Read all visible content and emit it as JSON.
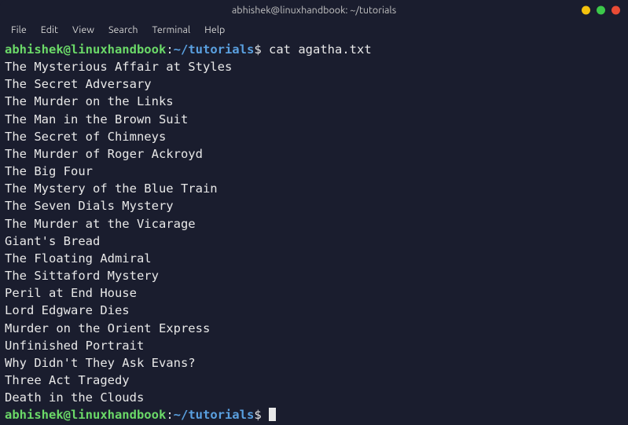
{
  "titlebar": {
    "title": "abhishek@linuxhandbook: ~/tutorials"
  },
  "menubar": {
    "items": [
      "File",
      "Edit",
      "View",
      "Search",
      "Terminal",
      "Help"
    ]
  },
  "prompt": {
    "user_host": "abhishek@linuxhandbook",
    "colon": ":",
    "cwd": "~/tutorials",
    "dollar": "$"
  },
  "command1": "cat agatha.txt",
  "output": [
    "The Mysterious Affair at Styles",
    "The Secret Adversary",
    "The Murder on the Links",
    "The Man in the Brown Suit",
    "The Secret of Chimneys",
    "The Murder of Roger Ackroyd",
    "The Big Four",
    "The Mystery of the Blue Train",
    "The Seven Dials Mystery",
    "The Murder at the Vicarage",
    "Giant's Bread",
    "The Floating Admiral",
    "The Sittaford Mystery",
    "Peril at End House",
    "Lord Edgware Dies",
    "Murder on the Orient Express",
    "Unfinished Portrait",
    "Why Didn't They Ask Evans?",
    "Three Act Tragedy",
    "Death in the Clouds"
  ],
  "command2": ""
}
